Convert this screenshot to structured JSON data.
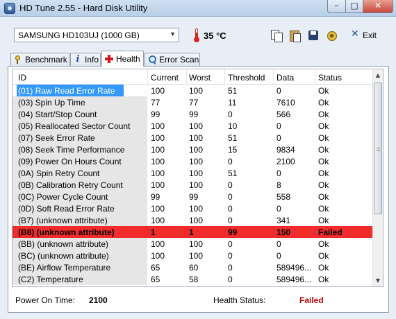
{
  "window": {
    "title": "HD Tune 2.55 - Hard Disk Utility",
    "controls": {
      "minimize": "–",
      "maximize": "□",
      "close": "✕"
    }
  },
  "toolbar": {
    "drive": "SAMSUNG HD103UJ (1000 GB)",
    "temperature": "35 °C",
    "exit_label": "Exit",
    "icons": [
      "copy-icon",
      "paste-icon",
      "save-icon",
      "options-icon",
      "exit-icon"
    ]
  },
  "tabs": [
    {
      "label": "Benchmark",
      "icon": "benchmark-icon"
    },
    {
      "label": "Info",
      "icon": "info-icon"
    },
    {
      "label": "Health",
      "icon": "health-icon",
      "active": true
    },
    {
      "label": "Error Scan",
      "icon": "error-scan-icon"
    }
  ],
  "table": {
    "headers": [
      "ID",
      "Current",
      "Worst",
      "Threshold",
      "Data",
      "Status"
    ],
    "rows": [
      [
        "(01) Raw Read Error Rate",
        "100",
        "100",
        "51",
        "0",
        "Ok"
      ],
      [
        "(03) Spin Up Time",
        "77",
        "77",
        "11",
        "7610",
        "Ok"
      ],
      [
        "(04) Start/Stop Count",
        "99",
        "99",
        "0",
        "566",
        "Ok"
      ],
      [
        "(05) Reallocated Sector Count",
        "100",
        "100",
        "10",
        "0",
        "Ok"
      ],
      [
        "(07) Seek Error Rate",
        "100",
        "100",
        "51",
        "0",
        "Ok"
      ],
      [
        "(08) Seek Time Performance",
        "100",
        "100",
        "15",
        "9834",
        "Ok"
      ],
      [
        "(09) Power On Hours Count",
        "100",
        "100",
        "0",
        "2100",
        "Ok"
      ],
      [
        "(0A) Spin Retry Count",
        "100",
        "100",
        "51",
        "0",
        "Ok"
      ],
      [
        "(0B) Calibration Retry Count",
        "100",
        "100",
        "0",
        "8",
        "Ok"
      ],
      [
        "(0C) Power Cycle Count",
        "99",
        "99",
        "0",
        "558",
        "Ok"
      ],
      [
        "(0D) Soft Read Error Rate",
        "100",
        "100",
        "0",
        "0",
        "Ok"
      ],
      [
        "(B7) (unknown attribute)",
        "100",
        "100",
        "0",
        "341",
        "Ok"
      ],
      [
        "(B8) (unknown attribute)",
        "1",
        "1",
        "99",
        "150",
        "Failed"
      ],
      [
        "(BB) (unknown attribute)",
        "100",
        "100",
        "0",
        "0",
        "Ok"
      ],
      [
        "(BC) (unknown attribute)",
        "100",
        "100",
        "0",
        "0",
        "Ok"
      ],
      [
        "(BE) Airflow Temperature",
        "65",
        "60",
        "0",
        "589496...",
        "Ok"
      ],
      [
        "(C2) Temperature",
        "65",
        "58",
        "0",
        "589496...",
        "Ok"
      ]
    ],
    "selected_row": 0,
    "failed_row": 12
  },
  "footer": {
    "power_on_time_label": "Power On Time:",
    "power_on_time_value": "2100",
    "health_status_label": "Health Status:",
    "health_status_value": "Failed"
  },
  "colors": {
    "selected_row": "#3399ff",
    "failed_row": "#ef2b2b",
    "failed_text": "#c00000"
  }
}
